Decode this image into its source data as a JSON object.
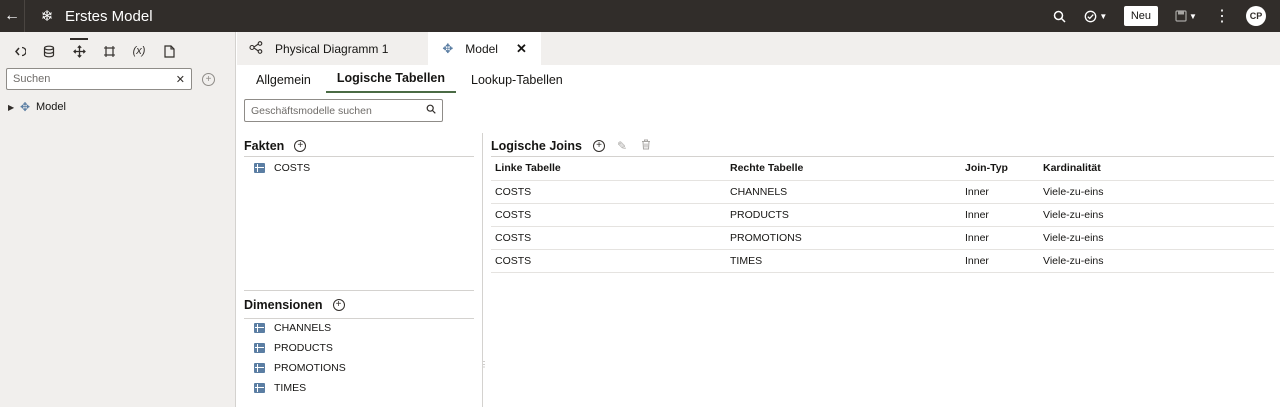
{
  "header": {
    "title": "Erstes Model",
    "new_label": "Neu",
    "avatar_initials": "CP",
    "bg_color": "#312d2a"
  },
  "left_panel": {
    "tools": [
      "add-source-icon",
      "database-icon",
      "model-icon",
      "frame-icon",
      "variable-icon",
      "document-icon"
    ],
    "variable_label": "(x)",
    "search_placeholder": "Suchen",
    "tree": [
      {
        "label": "Model"
      }
    ]
  },
  "tabs": [
    {
      "label": "Physical Diagramm 1"
    },
    {
      "label": "Model"
    }
  ],
  "subtabs": [
    {
      "label": "Allgemein"
    },
    {
      "label": "Logische Tabellen"
    },
    {
      "label": "Lookup-Tabellen"
    }
  ],
  "business_search_placeholder": "Geschäftsmodelle suchen",
  "facts": {
    "title": "Fakten",
    "items": [
      "COSTS"
    ]
  },
  "dimensions": {
    "title": "Dimensionen",
    "items": [
      "CHANNELS",
      "PRODUCTS",
      "PROMOTIONS",
      "TIMES"
    ]
  },
  "joins": {
    "title": "Logische Joins",
    "columns": [
      "Linke Tabelle",
      "Rechte Tabelle",
      "Join-Typ",
      "Kardinalität"
    ],
    "rows": [
      [
        "COSTS",
        "CHANNELS",
        "Inner",
        "Viele-zu-eins"
      ],
      [
        "COSTS",
        "PRODUCTS",
        "Inner",
        "Viele-zu-eins"
      ],
      [
        "COSTS",
        "PROMOTIONS",
        "Inner",
        "Viele-zu-eins"
      ],
      [
        "COSTS",
        "TIMES",
        "Inner",
        "Viele-zu-eins"
      ]
    ]
  }
}
